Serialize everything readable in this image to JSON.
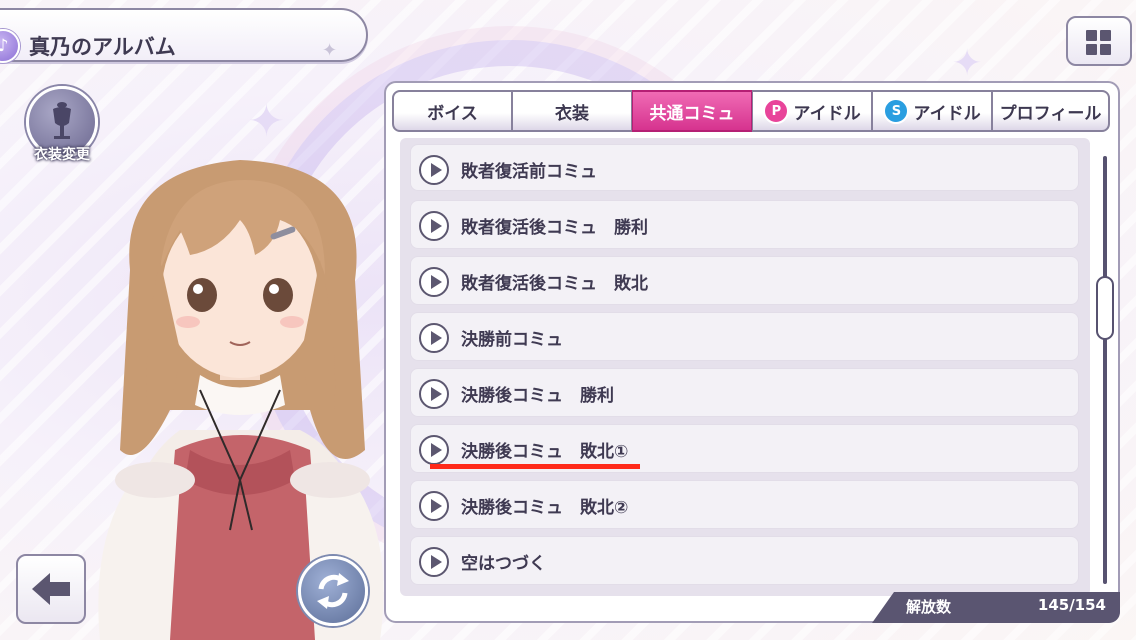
{
  "header": {
    "title": "真乃のアルバム",
    "title_icon": "note-icon"
  },
  "costume_button": {
    "label": "衣装変更"
  },
  "tabs": [
    {
      "label": "ボイス",
      "active": false
    },
    {
      "label": "衣装",
      "active": false
    },
    {
      "label": "共通コミュ",
      "active": true
    },
    {
      "badge": "P",
      "label": "アイドル",
      "badge_color": "#e8449a",
      "active": false
    },
    {
      "badge": "S",
      "label": "アイドル",
      "badge_color": "#2a9ee0",
      "active": false
    },
    {
      "label": "プロフィール",
      "active": false
    }
  ],
  "list": [
    {
      "label": "敗者復活前コミュ"
    },
    {
      "label": "敗者復活後コミュ　勝利"
    },
    {
      "label": "敗者復活後コミュ　敗北"
    },
    {
      "label": "決勝前コミュ"
    },
    {
      "label": "決勝後コミュ　勝利"
    },
    {
      "label": "決勝後コミュ　敗北①"
    },
    {
      "label": "決勝後コミュ　敗北②"
    },
    {
      "label": "空はつづく"
    }
  ],
  "counter": {
    "label": "解放数",
    "value": "145/154"
  },
  "colors": {
    "active_tab": "#e4469f",
    "highlight_underline": "#ff2a1a"
  }
}
